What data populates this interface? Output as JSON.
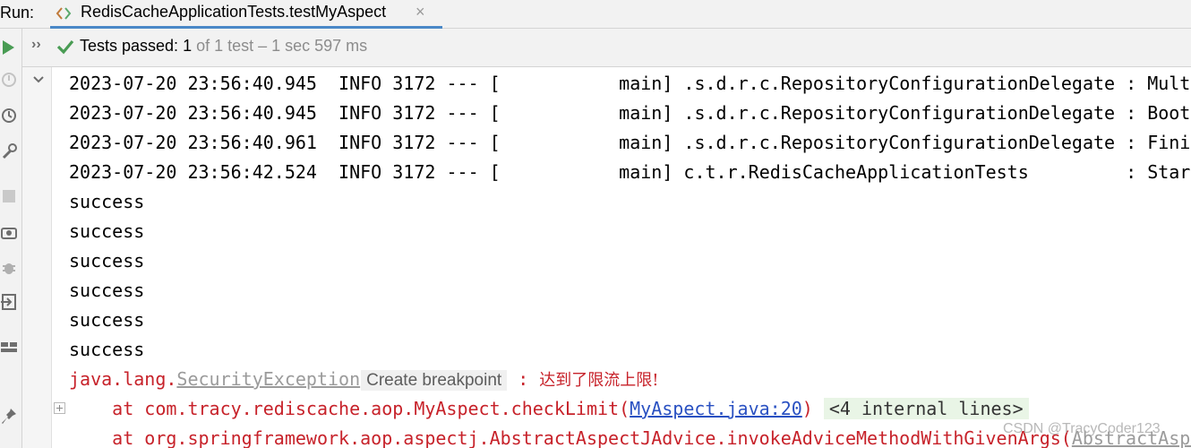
{
  "toolbar": {
    "run_label": "Run:",
    "tab_title": "RedisCacheApplicationTests.testMyAspect",
    "close_glyph": "×"
  },
  "status": {
    "passed_label": "Tests passed: ",
    "passed_count": "1",
    "detail": " of 1 test – 1 sec 597 ms"
  },
  "log_lines": [
    {
      "ts": "2023-07-20 23:56:40.945",
      "level": "INFO",
      "pid": "3172",
      "sep": "---",
      "thread": "main",
      "logger": ".s.d.r.c.RepositoryConfigurationDelegate",
      "msg": "Multi"
    },
    {
      "ts": "2023-07-20 23:56:40.945",
      "level": "INFO",
      "pid": "3172",
      "sep": "---",
      "thread": "main",
      "logger": ".s.d.r.c.RepositoryConfigurationDelegate",
      "msg": "Boots"
    },
    {
      "ts": "2023-07-20 23:56:40.961",
      "level": "INFO",
      "pid": "3172",
      "sep": "---",
      "thread": "main",
      "logger": ".s.d.r.c.RepositoryConfigurationDelegate",
      "msg": "Finis"
    },
    {
      "ts": "2023-07-20 23:56:42.524",
      "level": "INFO",
      "pid": "3172",
      "sep": "---",
      "thread": "main",
      "logger": "c.t.r.RedisCacheApplicationTests",
      "msg": "Start"
    }
  ],
  "success_lines": [
    "success",
    "success",
    "success",
    "success",
    "success",
    "success"
  ],
  "exception": {
    "prefix": "java.lang.",
    "class_name": "SecurityException",
    "breakpoint_hint": "Create breakpoint",
    "colon": " : ",
    "message": "达到了限流上限!"
  },
  "stack": [
    {
      "prefix": "    at com.tracy.rediscache.aop.MyAspect.checkLimit(",
      "link": "MyAspect.java:20",
      "suffix": ")",
      "fold": "<4 internal lines>"
    },
    {
      "prefix": "    at org.springframework.aop.aspectj.AbstractAspectJAdvice.invokeAdviceMethodWithGivenArgs(",
      "link": "AbstractAspe",
      "suffix": "",
      "fold": ""
    }
  ],
  "watermark": "CSDN @TracyCoder123",
  "colors": {
    "accent": "#4a88c7",
    "success_green": "#499c54",
    "error_red": "#c7222a",
    "link_blue": "#2a51c2"
  }
}
